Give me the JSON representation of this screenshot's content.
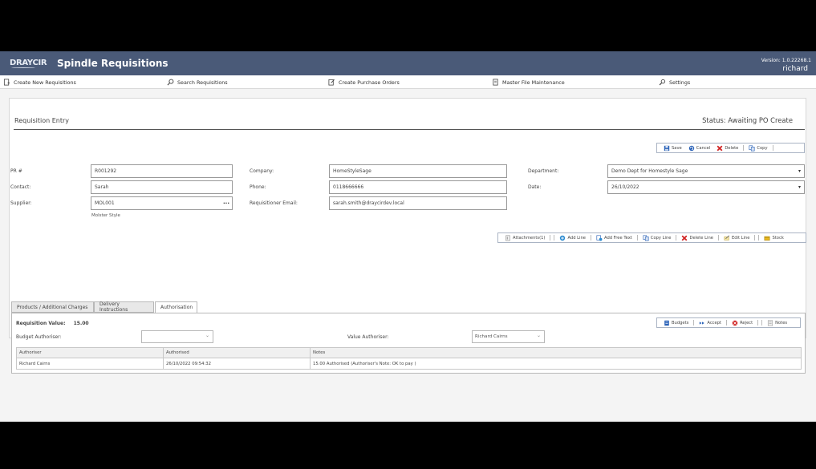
{
  "header": {
    "logo": "DRAYCIR",
    "app_title": "Spindle Requisitions",
    "version": "Version: 1.0.22268.1",
    "user": "richard"
  },
  "nav": [
    {
      "label": "Create New Requisitions",
      "icon": "new-doc-icon"
    },
    {
      "label": "Search Requisitions",
      "icon": "search-icon"
    },
    {
      "label": "Create Purchase Orders",
      "icon": "edit-doc-icon"
    },
    {
      "label": "Master File Maintenance",
      "icon": "file-icon"
    },
    {
      "label": "Settings",
      "icon": "gear-icon"
    }
  ],
  "page": {
    "title": "Requisition Entry",
    "status": "Status: Awaiting PO Create"
  },
  "toolbar": {
    "save": "Save",
    "cancel": "Cancel",
    "delete": "Delete",
    "copy": "Copy"
  },
  "form": {
    "pr_label": "PR #",
    "pr_value": "R001292",
    "contact_label": "Contact:",
    "contact_value": "Sarah",
    "supplier_label": "Supplier:",
    "supplier_value": "MOL001",
    "supplier_name": "Molster Style",
    "company_label": "Company:",
    "company_value": "HomeStyleSage",
    "phone_label": "Phone:",
    "phone_value": "0118666666",
    "email_label": "Requisitioner Email:",
    "email_value": "sarah.smith@draycirdev.local",
    "department_label": "Department:",
    "department_value": "Demo Dept for Homestyle Sage",
    "date_label": "Date:",
    "date_value": "26/10/2022"
  },
  "line_toolbar": {
    "attachments": "Attachments(1)",
    "add_line": "Add Line",
    "add_free_text": "Add Free Text",
    "copy_line": "Copy Line",
    "delete_line": "Delete Line",
    "edit_line": "Edit Line",
    "stock": "Stock"
  },
  "tabs": [
    {
      "label": "Products / Additional Charges"
    },
    {
      "label": "Delivery Instructions"
    },
    {
      "label": "Authorisation"
    }
  ],
  "auth": {
    "req_value_label": "Requisition Value:",
    "req_value": "15.00",
    "budget_auth_label": "Budget Authoriser:",
    "budget_auth_value": "",
    "value_auth_label": "Value Authoriser:",
    "value_auth_value": "Richard Cairns",
    "buttons": {
      "budgets": "Budgets",
      "accept": "Accept",
      "reject": "Reject",
      "notes": "Notes"
    },
    "table": {
      "headers": [
        "Authoriser",
        "Authorised",
        "Notes"
      ],
      "rows": [
        [
          "Richard Cairns",
          "26/10/2022 09:54:32",
          "15.00 Authorised (Authoriser's Note: OK to pay )"
        ]
      ]
    }
  },
  "colors": {
    "header_bg": "#4a5a78",
    "accent_blue": "#2a62b8",
    "danger_red": "#d02020"
  }
}
